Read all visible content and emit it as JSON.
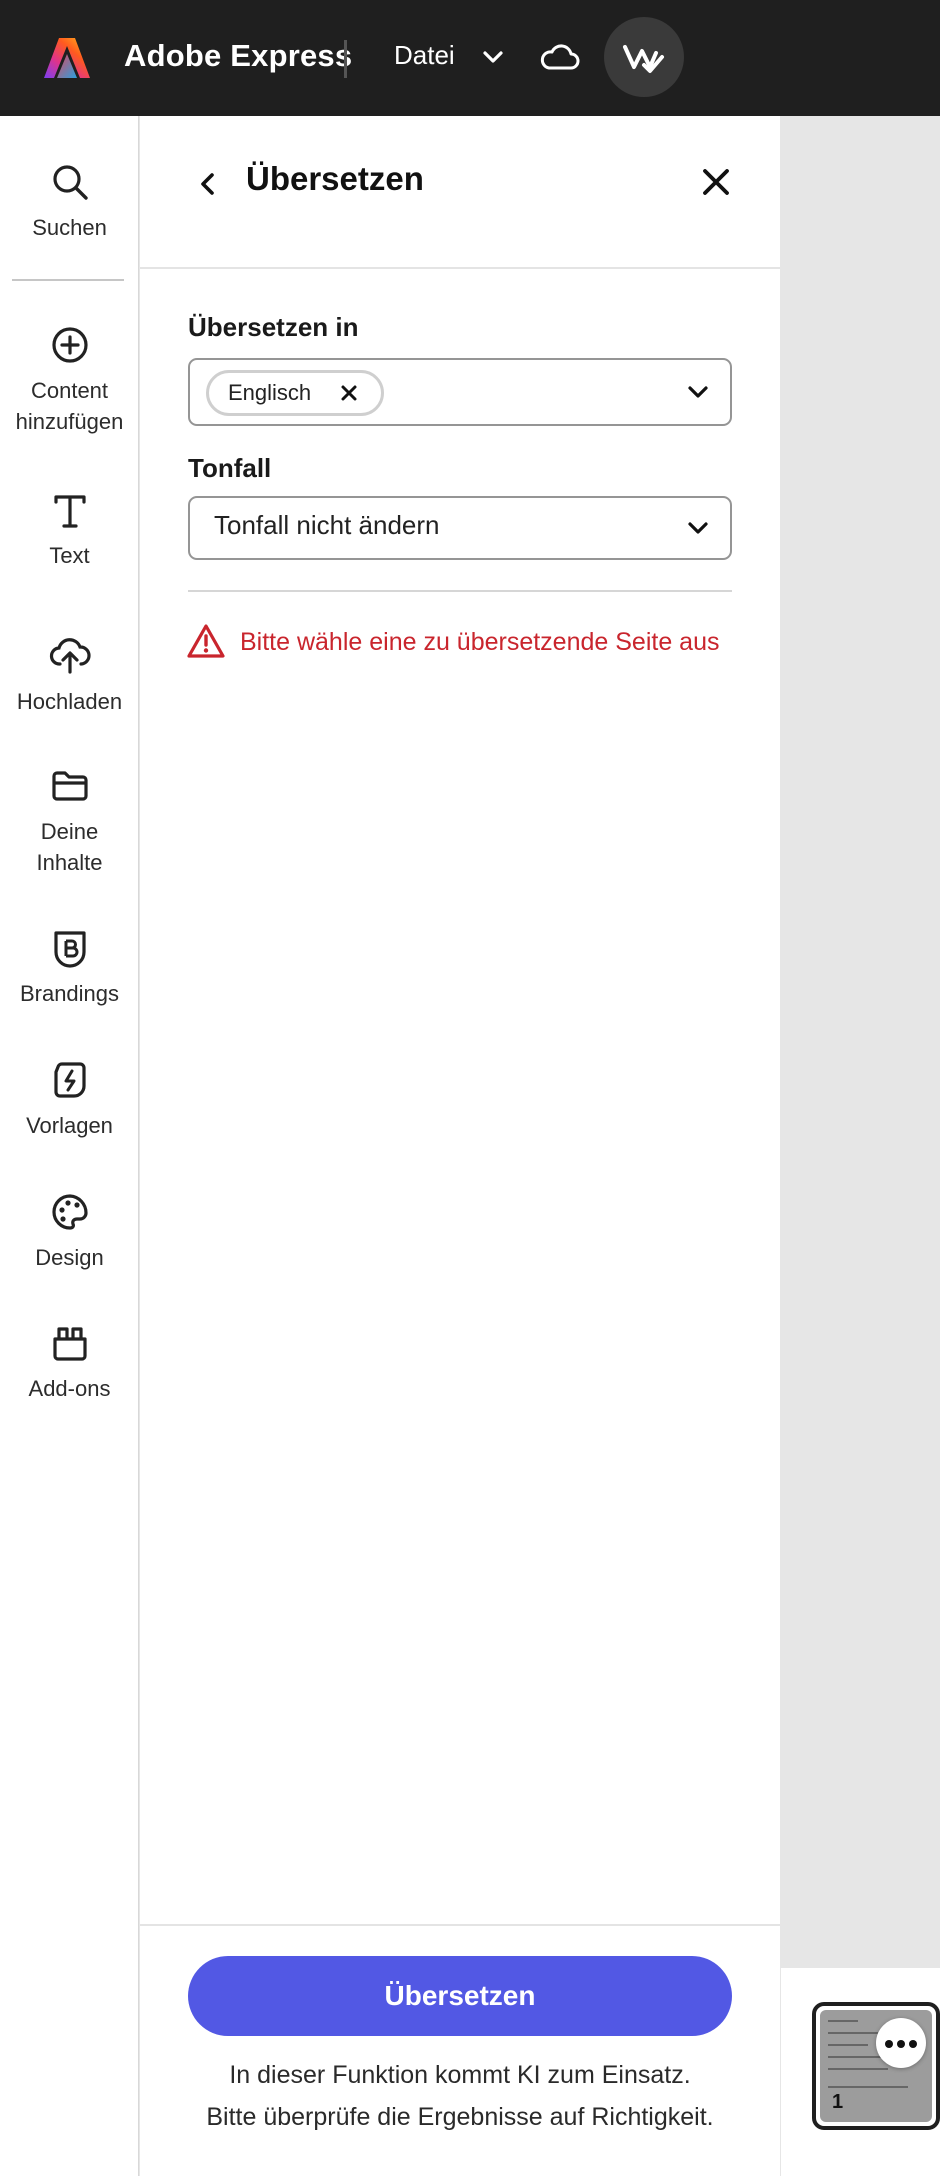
{
  "topbar": {
    "app_title": "Adobe Express",
    "file_menu": "Datei"
  },
  "rail": {
    "items": [
      {
        "label": "Suchen",
        "icon": "search-icon"
      },
      {
        "label": "Content\nhinzufügen",
        "icon": "plus-circle-icon"
      },
      {
        "label": "Text",
        "icon": "text-icon"
      },
      {
        "label": "Hochladen",
        "icon": "upload-cloud-icon"
      },
      {
        "label": "Deine\nInhalte",
        "icon": "folder-icon"
      },
      {
        "label": "Brandings",
        "icon": "brand-shield-icon"
      },
      {
        "label": "Vorlagen",
        "icon": "templates-icon"
      },
      {
        "label": "Design",
        "icon": "palette-icon"
      },
      {
        "label": "Add-ons",
        "icon": "addons-icon"
      }
    ]
  },
  "panel": {
    "title": "Übersetzen",
    "translate_to_label": "Übersetzen in",
    "selected_language": "Englisch",
    "tone_label": "Tonfall",
    "tone_value": "Tonfall nicht ändern",
    "warning": "Bitte wähle eine zu übersetzende Seite aus",
    "primary_button": "Übersetzen",
    "footnote_line1": "In dieser Funktion kommt KI zum Einsatz.",
    "footnote_line2": "Bitte überprüfe die Ergebnisse auf Richtigkeit."
  },
  "canvas": {
    "page_number": "1"
  },
  "colors": {
    "accent": "#5258e4",
    "warning": "#c9252d",
    "topbar": "#1f1f1f"
  }
}
